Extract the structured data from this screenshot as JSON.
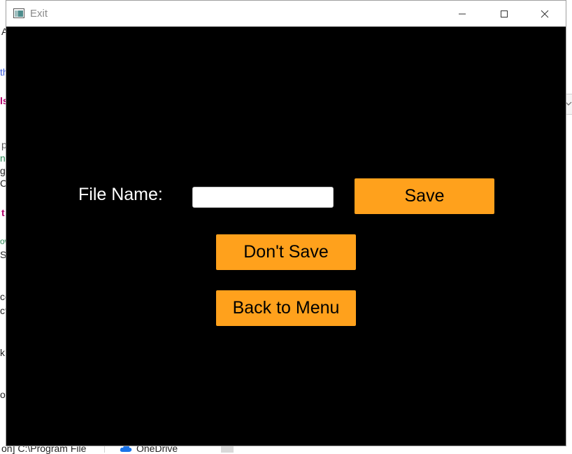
{
  "window": {
    "title": "Exit",
    "icons": {
      "app": "app-window-icon",
      "minimize": "minimize-icon",
      "maximize": "maximize-icon",
      "close": "close-icon"
    }
  },
  "form": {
    "file_name_label": "File Name:",
    "file_name_value": "",
    "save_label": "Save",
    "dont_save_label": "Don't Save",
    "back_label": "Back to Menu"
  },
  "colors": {
    "background": "#000000",
    "button": "#ffa11c",
    "label_text": "#ffffff",
    "button_text": "#000000"
  },
  "background_fragments": {
    "f1": "A",
    "f2": "th",
    "f3": "ls",
    "f4": "p",
    "f5": "ne",
    "f6": "ge",
    "f7": "Cm",
    "f8": "t",
    "f9": "ow",
    "f10": "Sc",
    "f11": "co",
    "f12": "ct",
    "f13": "k",
    "f14": "os",
    "taskbar_path": "on] C:\\Program File",
    "taskbar_onedrive": "OneDrive"
  }
}
